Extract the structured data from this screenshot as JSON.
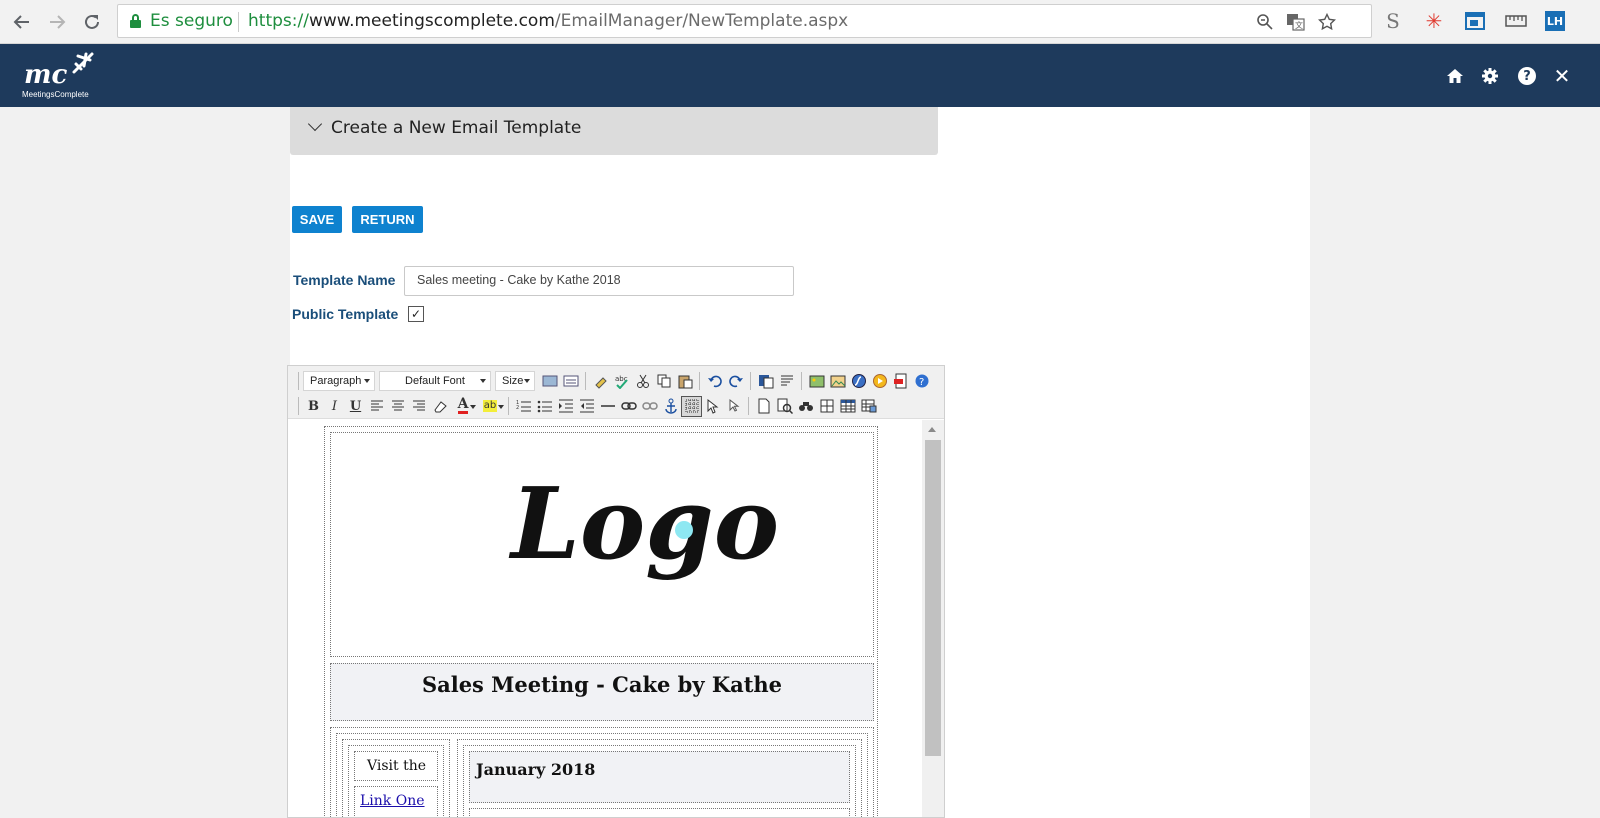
{
  "browser": {
    "secure_label": "Es seguro",
    "url_scheme": "https://",
    "url_host": "www.meetingscomplete.com",
    "url_path": "/EmailManager/NewTemplate.aspx",
    "nav_icons": [
      "back-arrow-icon",
      "forward-arrow-icon",
      "reload-icon"
    ],
    "omnibox_icons": [
      "zoom-icon",
      "translate-icon",
      "bookmark-star-icon"
    ],
    "extension_icons": [
      "s-extension-icon",
      "asterisk-extension-icon",
      "window-extension-icon",
      "ruler-extension-icon",
      "lh-extension-icon"
    ],
    "ext_s": "S",
    "ext_asterisk": "✳",
    "ext_lh": "LH"
  },
  "header": {
    "brand_mark": "mc",
    "brand_name": "MeetingsComplete",
    "icons": [
      "home-icon",
      "settings-gear-icon",
      "help-icon",
      "close-icon"
    ],
    "help_glyph": "?",
    "close_glyph": "✕",
    "bg_color": "#1e3a5c"
  },
  "page": {
    "section_title": "Create a New Email Template",
    "save_label": "SAVE",
    "return_label": "RETURN",
    "accent_color": "#0e82cf"
  },
  "form": {
    "template_name_label": "Template Name",
    "template_name_value": "Sales meeting - Cake by Kathe 2018",
    "public_template_label": "Public Template",
    "public_template_checked": true,
    "checkmark": "✓"
  },
  "editor": {
    "toolbar": {
      "paragraph_select": "Paragraph",
      "font_select": "Default Font",
      "size_select": "Size",
      "bold": "B",
      "italic": "I",
      "underline": "U",
      "font_color_glyph": "A",
      "highlight_glyph": "ab"
    },
    "content": {
      "logo_text": "Logo",
      "heading": "Sales Meeting - Cake by Kathe",
      "sidebar_text": "Visit the",
      "link_one": "Link One",
      "date_heading": "January 2018"
    }
  }
}
